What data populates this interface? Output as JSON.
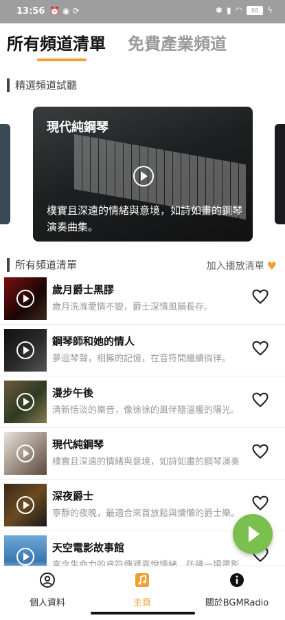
{
  "status_bar": {
    "time": "13:56",
    "left_icons": [
      "alarm-icon",
      "notification-icon",
      "sync-icon"
    ],
    "battery_level": "88"
  },
  "tabs": [
    {
      "label": "所有頻道清單",
      "active": true
    },
    {
      "label": "免費產業頻道",
      "active": false
    }
  ],
  "featured": {
    "section_title": "精選頻道試聽",
    "card": {
      "title": "現代純鋼琴",
      "description": "樸實且深遠的情緒與意境，如詩如畫的鋼琴演奏曲集。"
    }
  },
  "channel_list": {
    "section_title": "所有頻道清單",
    "add_playlist_label": "加入播放清單",
    "items": [
      {
        "title": "歲月爵士黑膠",
        "description": "歲月洗滌愛情不變，爵士深情風韻長存。"
      },
      {
        "title": "鋼琴師和她的情人",
        "description": "夢迴琴聲，相擁的記憶，在音符間繼續徜徉。"
      },
      {
        "title": "漫步午後",
        "description": "清新恬淡的樂音，像徐徐的風伴隨溫暖的陽光。"
      },
      {
        "title": "現代純鋼琴",
        "description": "樸實且深遠的情緒與意境，如詩如畫的鋼琴演奏曲集。"
      },
      {
        "title": "深夜爵士",
        "description": "寧靜的夜晚，最適合來首放鬆與慵懶的爵士樂。"
      },
      {
        "title": "天空電影故事館",
        "description": "富含生命力的音符傳遞喜悅情緒，彷彿一場電影。"
      }
    ]
  },
  "bottom_nav": {
    "items": [
      {
        "label": "個人資料",
        "icon": "profile-icon"
      },
      {
        "label": "主頁",
        "icon": "home-music-icon"
      },
      {
        "label": "關於BGMRadio",
        "icon": "info-icon"
      }
    ]
  },
  "colors": {
    "accent": "#f0a030",
    "fab": "#7bbf4e"
  }
}
